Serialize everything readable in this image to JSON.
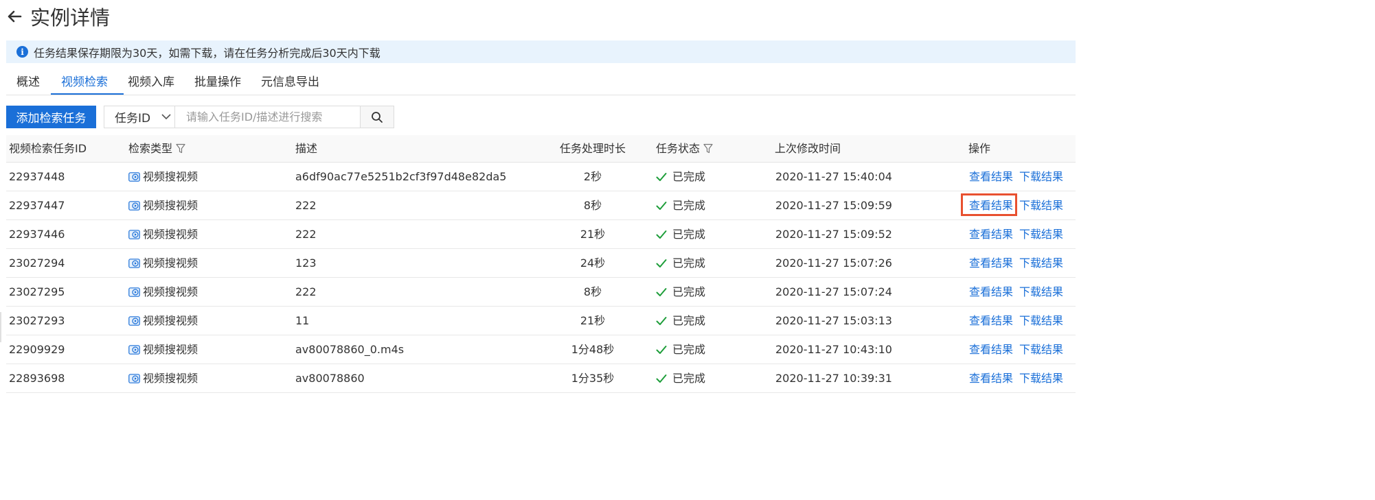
{
  "header": {
    "title": "实例详情"
  },
  "notice": {
    "text": "任务结果保存期限为30天，如需下载，请在任务分析完成后30天内下载"
  },
  "tabs": [
    {
      "label": "概述",
      "active": false
    },
    {
      "label": "视频检索",
      "active": true
    },
    {
      "label": "视频入库",
      "active": false
    },
    {
      "label": "批量操作",
      "active": false
    },
    {
      "label": "元信息导出",
      "active": false
    }
  ],
  "toolbar": {
    "add_label": "添加检索任务",
    "select_value": "任务ID",
    "search_placeholder": "请输入任务ID/描述进行搜索"
  },
  "table": {
    "headers": {
      "id": "视频检索任务ID",
      "type": "检索类型",
      "desc": "描述",
      "duration": "任务处理时长",
      "status": "任务状态",
      "modified": "上次修改时间",
      "actions": "操作"
    },
    "rows": [
      {
        "id": "22937448",
        "type": "视频搜视频",
        "desc": "a6df90ac77e5251b2cf3f97d48e82da5",
        "duration": "2秒",
        "status": "已完成",
        "modified": "2020-11-27 15:40:04",
        "view": "查看结果",
        "download": "下载结果"
      },
      {
        "id": "22937447",
        "type": "视频搜视频",
        "desc": "222",
        "duration": "8秒",
        "status": "已完成",
        "modified": "2020-11-27 15:09:59",
        "view": "查看结果",
        "download": "下载结果"
      },
      {
        "id": "22937446",
        "type": "视频搜视频",
        "desc": "222",
        "duration": "21秒",
        "status": "已完成",
        "modified": "2020-11-27 15:09:52",
        "view": "查看结果",
        "download": "下载结果"
      },
      {
        "id": "23027294",
        "type": "视频搜视频",
        "desc": "123",
        "duration": "24秒",
        "status": "已完成",
        "modified": "2020-11-27 15:07:26",
        "view": "查看结果",
        "download": "下载结果"
      },
      {
        "id": "23027295",
        "type": "视频搜视频",
        "desc": "222",
        "duration": "8秒",
        "status": "已完成",
        "modified": "2020-11-27 15:07:24",
        "view": "查看结果",
        "download": "下载结果"
      },
      {
        "id": "23027293",
        "type": "视频搜视频",
        "desc": "11",
        "duration": "21秒",
        "status": "已完成",
        "modified": "2020-11-27 15:03:13",
        "view": "查看结果",
        "download": "下载结果"
      },
      {
        "id": "22909929",
        "type": "视频搜视频",
        "desc": "av80078860_0.m4s",
        "duration": "1分48秒",
        "status": "已完成",
        "modified": "2020-11-27 10:43:10",
        "view": "查看结果",
        "download": "下载结果"
      },
      {
        "id": "22893698",
        "type": "视频搜视频",
        "desc": "av80078860",
        "duration": "1分35秒",
        "status": "已完成",
        "modified": "2020-11-27 10:39:31",
        "view": "查看结果",
        "download": "下载结果"
      }
    ]
  },
  "colors": {
    "accent": "#1a6fd8",
    "success": "#1e9e3a",
    "highlight": "#e8502f",
    "notice_bg": "#e8f3fd"
  },
  "icons": {
    "back": "arrow-left-icon",
    "info": "info-icon",
    "dropdown": "chevron-down-icon",
    "search": "search-icon",
    "filter": "filter-icon",
    "type": "video-play-icon",
    "status": "check-icon"
  }
}
